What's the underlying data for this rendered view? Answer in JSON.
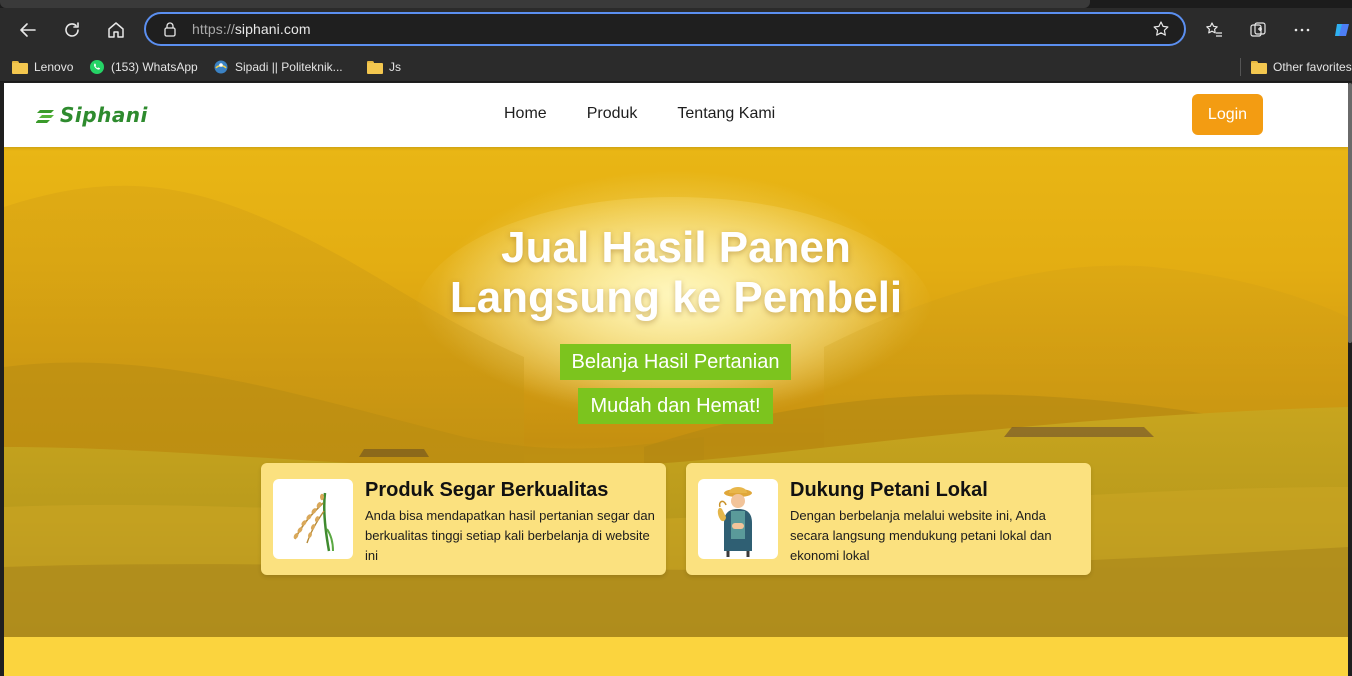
{
  "browser": {
    "url_protocol": "https://",
    "url_host": "siphani.com",
    "bookmarks": [
      {
        "label": "Lenovo",
        "icon": "folder-icon"
      },
      {
        "label": "(153) WhatsApp",
        "icon": "whatsapp-icon"
      },
      {
        "label": "Sipadi || Politeknik...",
        "icon": "site-icon"
      },
      {
        "label": "Js",
        "icon": "folder-icon"
      }
    ],
    "other_favorites": "Other favorites"
  },
  "site": {
    "logo_text": "Siphani",
    "nav": [
      "Home",
      "Produk",
      "Tentang Kami"
    ],
    "login_label": "Login",
    "accent_color": "#f39c12",
    "brand_green": "#7cc41e"
  },
  "hero": {
    "title_line1": "Jual Hasil Panen",
    "title_line2": "Langsung ke Pembeli",
    "pill1": "Belanja Hasil Pertanian",
    "pill2": "Mudah dan Hemat!"
  },
  "features": [
    {
      "title": "Produk Segar Berkualitas",
      "text": "Anda bisa mendapatkan hasil pertanian segar dan berkualitas tinggi setiap kali berbelanja di website ini",
      "icon": "rice-stalk-icon"
    },
    {
      "title": "Dukung Petani Lokal",
      "text": "Dengan berbelanja melalui website ini, Anda secara langsung mendukung petani lokal dan ekonomi lokal",
      "icon": "farmer-icon"
    }
  ]
}
